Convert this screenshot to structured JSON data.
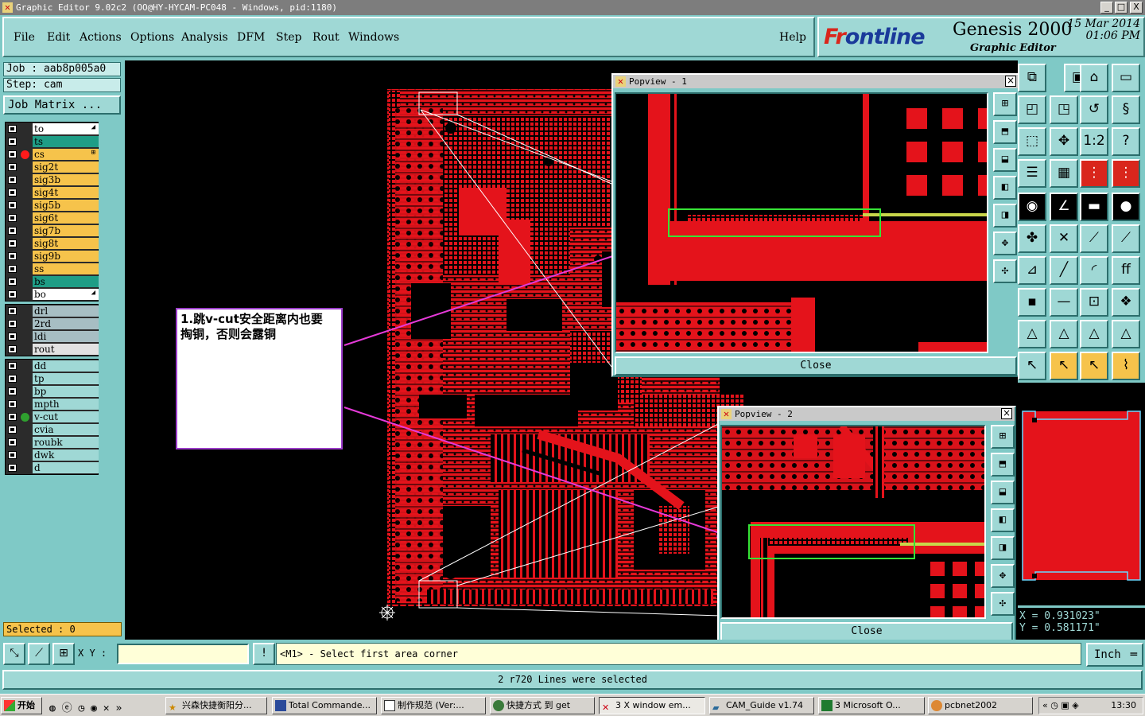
{
  "window": {
    "title": "Graphic Editor 9.02c2 (OO@HY-HYCAM-PC048 - Windows, pid:1180)",
    "min": "_",
    "max": "□",
    "close": "X"
  },
  "menu": [
    "File",
    "Edit",
    "Actions",
    "Options",
    "Analysis",
    "DFM",
    "Step",
    "Rout",
    "Windows"
  ],
  "help": "Help",
  "brand": {
    "logo_a": "Fr",
    "logo_b": "ontline",
    "product": "Genesis 2000",
    "subtitle": "Graphic Editor",
    "date": "15 Mar 2014",
    "time": "01:06 PM"
  },
  "job": {
    "job": "Job : aab8p005a0",
    "step": "Step: cam",
    "matrix_button": "Job Matrix ..."
  },
  "layer_groups": [
    [
      {
        "name": "to",
        "color": "#ffffff",
        "mark": "◢"
      },
      {
        "name": "ts",
        "color": "#1f9d86"
      },
      {
        "name": "cs",
        "color": "#f6c34b",
        "dot": "#ff1b1b",
        "mark": "⊞"
      },
      {
        "name": "sig2t",
        "color": "#f6c34b"
      },
      {
        "name": "sig3b",
        "color": "#f6c34b"
      },
      {
        "name": "sig4t",
        "color": "#f6c34b"
      },
      {
        "name": "sig5b",
        "color": "#f6c34b"
      },
      {
        "name": "sig6t",
        "color": "#f6c34b"
      },
      {
        "name": "sig7b",
        "color": "#f6c34b"
      },
      {
        "name": "sig8t",
        "color": "#f6c34b"
      },
      {
        "name": "sig9b",
        "color": "#f6c34b"
      },
      {
        "name": "ss",
        "color": "#f6c34b"
      },
      {
        "name": "bs",
        "color": "#1f9d86"
      },
      {
        "name": "bo",
        "color": "#ffffff",
        "mark": "◢"
      }
    ],
    [
      {
        "name": "drl",
        "color": "#a7bec3"
      },
      {
        "name": "2rd",
        "color": "#a7bec3"
      },
      {
        "name": "ldi",
        "color": "#a7bec3"
      },
      {
        "name": "rout",
        "color": "#e2e2e2"
      }
    ],
    [
      {
        "name": "dd",
        "color": "#9fd8d5"
      },
      {
        "name": "tp",
        "color": "#9fd8d5"
      },
      {
        "name": "bp",
        "color": "#9fd8d5"
      },
      {
        "name": "mpth",
        "color": "#9fd8d5"
      },
      {
        "name": "v-cut",
        "color": "#9fd8d5",
        "dot": "#2fa02f"
      },
      {
        "name": "cvia",
        "color": "#9fd8d5"
      },
      {
        "name": "roubk",
        "color": "#9fd8d5"
      },
      {
        "name": "dwk",
        "color": "#9fd8d5"
      },
      {
        "name": "d",
        "color": "#9fd8d5"
      }
    ]
  ],
  "selected": "Selected : 0",
  "annotation": {
    "line1": "1.跳v-cut安全距离内也要",
    "line2": "掏铜，否则会露铜"
  },
  "popview1": {
    "title": "Popview - 1",
    "close": "Close"
  },
  "popview2": {
    "title": "Popview - 2",
    "close": "Close"
  },
  "coords": {
    "x": "X = 0.931023\"",
    "y": "Y = 0.581171\""
  },
  "cmd": {
    "xy_label": "X Y :",
    "xy_value": "",
    "alert": "!",
    "prompt": "<M1> - Select first area corner",
    "units": "Inch"
  },
  "status": "2 r720 Lines were selected",
  "taskbar": {
    "start": "开始",
    "items": [
      "兴森快捷衡阳分...",
      "Total Commande...",
      "制作规范  (Ver:...",
      "快捷方式 到 get",
      "3 X window em...",
      "CAM_Guide v1.74",
      "3 Microsoft O...",
      "pcbnet2002"
    ],
    "clock": "13:30"
  }
}
